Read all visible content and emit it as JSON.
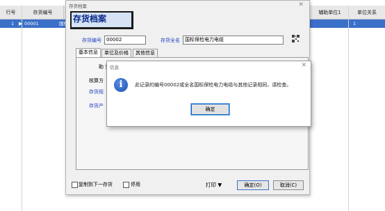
{
  "grid": {
    "columns": [
      "行号",
      "存货编号",
      "辅助单位1",
      "单位关系"
    ],
    "row": {
      "num": "1",
      "code": "00001",
      "name_partial": "国标",
      "rel": "1"
    }
  },
  "dialog": {
    "title": "存货档案",
    "banner": "存货档案",
    "code_label": "存货编号",
    "code_value": "00002",
    "fullname_label": "存货全名",
    "fullname_value": "国标保检电力电缆",
    "tabs": [
      "基本信息",
      "单位及价格",
      "其他信息"
    ],
    "fields": [
      "助 记",
      "核算方",
      "存货规",
      "存货产"
    ],
    "chk_copy_label": "复制到下一存货",
    "chk_stop_label": "停用",
    "print_label": "打印 ▼",
    "ok_label": "确定(O)",
    "cancel_label": "取消(C)"
  },
  "info": {
    "title": "信息",
    "icon": "info-icon",
    "message": "此记录的编号00002或全名国标保检电力电缆与其他记录相同，请检查。",
    "ok_label": "确定"
  },
  "colors": {
    "selection": "#3b70c9",
    "label_blue": "#1f3fbf",
    "banner_bg": "#d6e3f5"
  }
}
